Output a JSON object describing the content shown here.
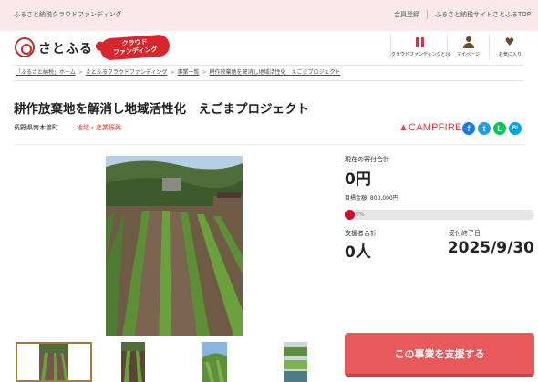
{
  "topbar": {
    "left_text": "ふるさと納税クラウドファンディング",
    "links": [
      "会員登録",
      "ふるさと納税サイトさとふるTOP"
    ]
  },
  "header": {
    "logo_text": "さとふる",
    "badge_line1": "クラウド",
    "badge_line2": "ファンディング",
    "nav": [
      {
        "label": "クラウドファンディングとは",
        "icon": "book-icon"
      },
      {
        "label": "マイページ",
        "icon": "person-icon"
      },
      {
        "label": "お気に入り",
        "icon": "heart-icon"
      }
    ]
  },
  "breadcrumb": {
    "items": [
      "「ふるさと納税」ホーム",
      "さとふるクラウドファンディング",
      "事業一覧",
      "耕作放棄地を解消し地域活性化　えごまプロジェクト"
    ]
  },
  "project": {
    "title": "耕作放棄地を解消し地域活性化　えごまプロジェクト",
    "location": "長野県南木曽町",
    "category": "地域・産業振興",
    "partner_logo": "CAMPFIRE"
  },
  "share": {
    "facebook": "f",
    "twitter": "t",
    "line": "L",
    "hatena": "B!"
  },
  "stats": {
    "donation_label": "現在の寄付合計",
    "donation_amount": "0円",
    "goal_text": "目標金額: 800,000円",
    "progress_percent": 0,
    "progress_text": "0%",
    "supporters_label": "支援者合計",
    "supporters_count": "0人",
    "end_label": "受付終了日",
    "end_date": "2025/9/30"
  },
  "cta": {
    "support_button": "この事業を支援する"
  },
  "colors": {
    "accent_red": "#c8102e",
    "button_red": "#e8595c",
    "topbar_pink": "#fbe9ea",
    "campfire_red": "#e63c3c"
  }
}
